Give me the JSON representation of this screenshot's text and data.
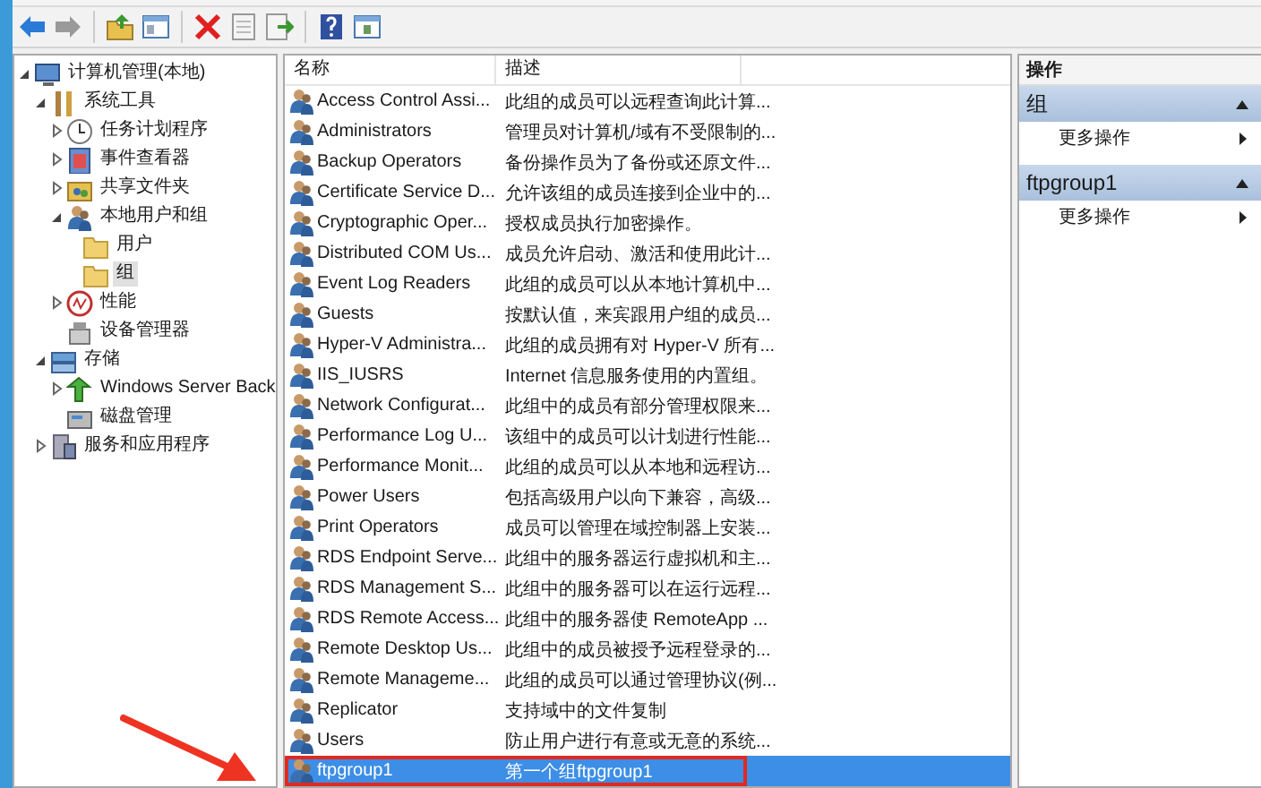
{
  "tree": [
    {
      "label": "计算机管理(本地)",
      "kind": "computer",
      "selected": false,
      "expanded": true,
      "children": [
        {
          "label": "系统工具",
          "kind": "tools",
          "selected": false,
          "expanded": true,
          "children": [
            {
              "label": "任务计划程序",
              "kind": "clock",
              "selected": false,
              "expanded": false
            },
            {
              "label": "事件查看器",
              "kind": "log",
              "selected": false,
              "expanded": false
            },
            {
              "label": "共享文件夹",
              "kind": "share",
              "selected": false,
              "expanded": false
            },
            {
              "label": "本地用户和组",
              "kind": "users",
              "selected": false,
              "expanded": true,
              "children": [
                {
                  "label": "用户",
                  "kind": "folder",
                  "selected": false
                },
                {
                  "label": "组",
                  "kind": "folder",
                  "selected": true
                }
              ]
            },
            {
              "label": "性能",
              "kind": "perf",
              "selected": false,
              "expanded": false
            },
            {
              "label": "设备管理器",
              "kind": "device",
              "selected": false
            }
          ]
        },
        {
          "label": "存储",
          "kind": "storage",
          "selected": false,
          "expanded": true,
          "children": [
            {
              "label": "Windows Server Back",
              "kind": "backup",
              "selected": false,
              "expanded": false
            },
            {
              "label": "磁盘管理",
              "kind": "disk",
              "selected": false
            }
          ]
        },
        {
          "label": "服务和应用程序",
          "kind": "services",
          "selected": false,
          "expanded": false
        }
      ]
    }
  ],
  "list": {
    "columns": [
      "名称",
      "描述"
    ],
    "rows": [
      {
        "name": "Access Control Assi...",
        "description": "此组的成员可以远程查询此计算...",
        "selected": false,
        "outlined": false
      },
      {
        "name": "Administrators",
        "description": "管理员对计算机/域有不受限制的...",
        "selected": false,
        "outlined": false
      },
      {
        "name": "Backup Operators",
        "description": "备份操作员为了备份或还原文件...",
        "selected": false,
        "outlined": false
      },
      {
        "name": "Certificate Service D...",
        "description": "允许该组的成员连接到企业中的...",
        "selected": false,
        "outlined": false
      },
      {
        "name": "Cryptographic Oper...",
        "description": "授权成员执行加密操作。",
        "selected": false,
        "outlined": false
      },
      {
        "name": "Distributed COM Us...",
        "description": "成员允许启动、激活和使用此计...",
        "selected": false,
        "outlined": false
      },
      {
        "name": "Event Log Readers",
        "description": "此组的成员可以从本地计算机中...",
        "selected": false,
        "outlined": false
      },
      {
        "name": "Guests",
        "description": "按默认值，来宾跟用户组的成员...",
        "selected": false,
        "outlined": false
      },
      {
        "name": "Hyper-V Administra...",
        "description": "此组的成员拥有对 Hyper-V 所有...",
        "selected": false,
        "outlined": false
      },
      {
        "name": "IIS_IUSRS",
        "description": "Internet 信息服务使用的内置组。",
        "selected": false,
        "outlined": false
      },
      {
        "name": "Network Configurat...",
        "description": "此组中的成员有部分管理权限来...",
        "selected": false,
        "outlined": false
      },
      {
        "name": "Performance Log U...",
        "description": "该组中的成员可以计划进行性能...",
        "selected": false,
        "outlined": false
      },
      {
        "name": "Performance Monit...",
        "description": "此组的成员可以从本地和远程访...",
        "selected": false,
        "outlined": false
      },
      {
        "name": "Power Users",
        "description": "包括高级用户以向下兼容，高级...",
        "selected": false,
        "outlined": false
      },
      {
        "name": "Print Operators",
        "description": "成员可以管理在域控制器上安装...",
        "selected": false,
        "outlined": false
      },
      {
        "name": "RDS Endpoint Serve...",
        "description": "此组中的服务器运行虚拟机和主...",
        "selected": false,
        "outlined": false
      },
      {
        "name": "RDS Management S...",
        "description": "此组中的服务器可以在运行远程...",
        "selected": false,
        "outlined": false
      },
      {
        "name": "RDS Remote Access...",
        "description": "此组中的服务器使 RemoteApp ...",
        "selected": false,
        "outlined": false
      },
      {
        "name": "Remote Desktop Us...",
        "description": "此组中的成员被授予远程登录的...",
        "selected": false,
        "outlined": false
      },
      {
        "name": "Remote Manageme...",
        "description": "此组的成员可以通过管理协议(例...",
        "selected": false,
        "outlined": false
      },
      {
        "name": "Replicator",
        "description": "支持域中的文件复制",
        "selected": false,
        "outlined": false
      },
      {
        "name": "Users",
        "description": "防止用户进行有意或无意的系统...",
        "selected": false,
        "outlined": false
      },
      {
        "name": "ftpgroup1",
        "description": "第一个组ftpgroup1",
        "selected": true,
        "outlined": true
      }
    ]
  },
  "actions": {
    "title": "操作",
    "sections": [
      {
        "title": "组",
        "items": [
          {
            "label": "更多操作"
          }
        ]
      },
      {
        "title": "ftpgroup1",
        "items": [
          {
            "label": "更多操作"
          }
        ]
      }
    ]
  }
}
